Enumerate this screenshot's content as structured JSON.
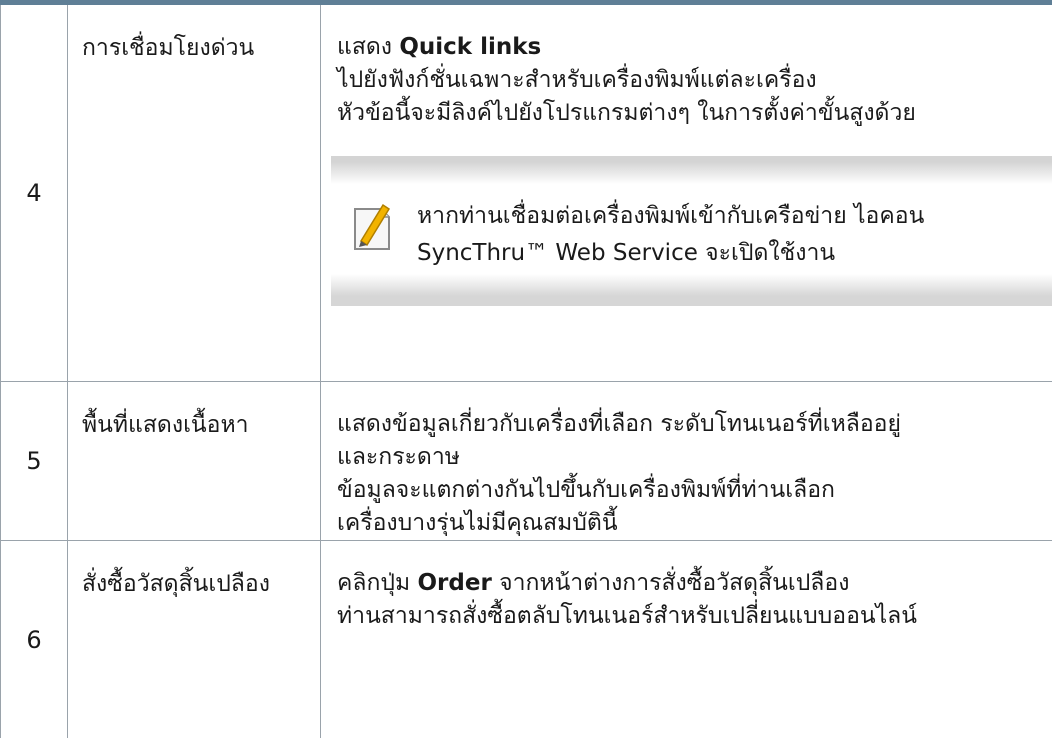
{
  "rows": [
    {
      "number": "4",
      "name": "การเชื่อมโยงด่วน",
      "desc_prefix": "แสดง ",
      "desc_bold": "Quick links",
      "desc_lines": [
        "ไปยังฟังก์ชั่นเฉพาะสำหรับเครื่องพิมพ์แต่ละเครื่อง",
        "หัวข้อนี้จะมีลิงค์ไปยังโปรแกรมต่างๆ ในการตั้งค่าขั้นสูงด้วย"
      ],
      "note": {
        "icon": "note-pencil-icon",
        "line1": "หากท่านเชื่อมต่อเครื่องพิมพ์เข้ากับเครือข่าย ไอคอน",
        "line2": "SyncThru™ Web Service จะเปิดใช้งาน"
      }
    },
    {
      "number": "5",
      "name": "พื้นที่แสดงเนื้อหา",
      "desc_lines": [
        "แสดงข้อมูลเกี่ยวกับเครื่องที่เลือก ระดับโทนเนอร์ที่เหลืออยู่",
        "และกระดาษ",
        "ข้อมูลจะแตกต่างกันไปขึ้นกับเครื่องพิมพ์ที่ท่านเลือก",
        "เครื่องบางรุ่นไม่มีคุณสมบัตินี้"
      ]
    },
    {
      "number": "6",
      "name": "สั่งซื้อวัสดุสิ้นเปลือง",
      "desc_prefix": "คลิกปุ่ม ",
      "desc_bold": "Order",
      "desc_suffix": " จากหน้าต่างการสั่งซื้อวัสดุสิ้นเปลือง",
      "desc_lines": [
        "ท่านสามารถสั่งซื้อตลับโทนเนอร์สำหรับเปลี่ยนแบบออนไลน์"
      ]
    }
  ],
  "colors": {
    "top_bar": "#5f7f96",
    "border": "#9aa3ab",
    "note_band": "#d4d4d4",
    "icon_pencil": "#f2b300"
  }
}
